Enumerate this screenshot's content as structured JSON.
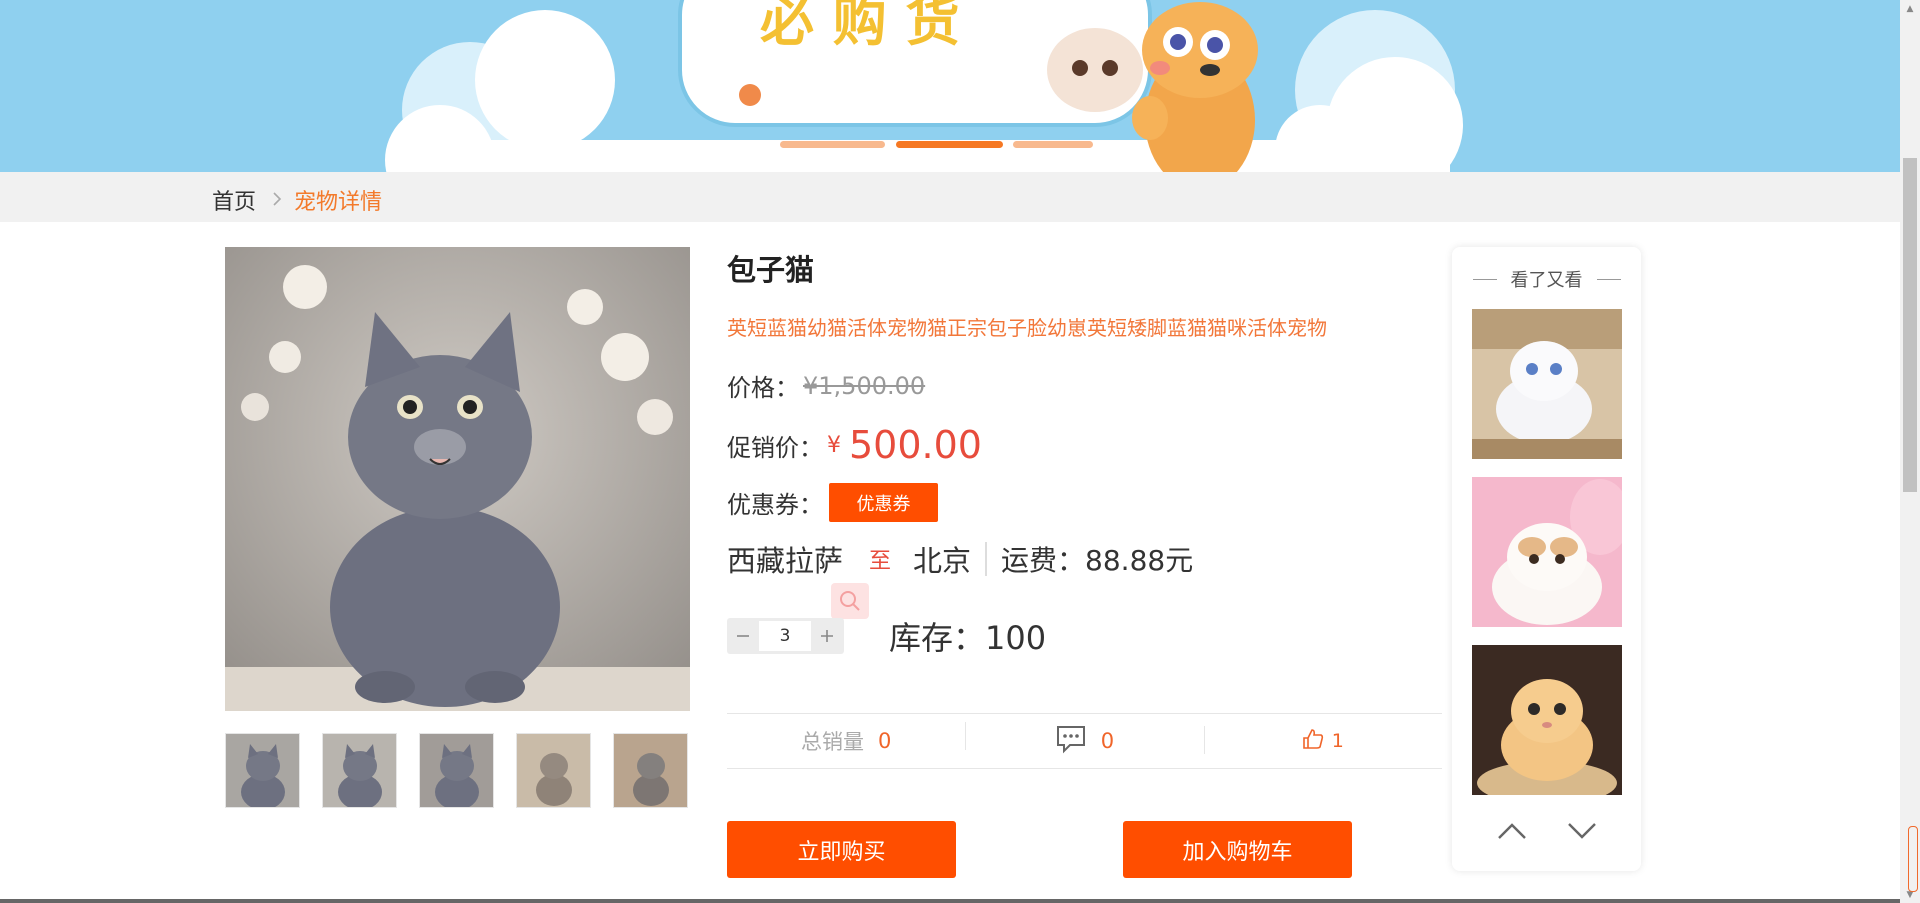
{
  "breadcrumb": {
    "home": "首页",
    "separator": ">",
    "current": "宠物详情"
  },
  "product": {
    "name": "包子猫",
    "subtitle": "英短蓝猫幼猫活体宠物猫正宗包子脸幼崽英短矮脚蓝猫猫咪活体宠物",
    "price_label": "价格：",
    "original_price": "¥1,500.00",
    "promo_label": "促销价：",
    "currency": "¥",
    "promo_price": "500.00",
    "coupon_label": "优惠券：",
    "coupon_button": "优惠券",
    "ship_from": "西藏拉萨",
    "ship_to_word": "至",
    "ship_to": "北京",
    "shipping_fee": "运费：88.88元",
    "quantity": "3",
    "stock": "库存：100",
    "stats": {
      "sales_label": "总销量",
      "sales_value": "0",
      "comments_value": "0",
      "likes_value": "1"
    },
    "buy_now": "立即购买",
    "add_to_cart": "加入购物车"
  },
  "side_panel": {
    "title": "看了又看"
  },
  "colors": {
    "accent": "#ff4e00",
    "price_red": "#e74c3c",
    "orange_text": "#f2773a",
    "banner_sky": "#8fd0ef"
  },
  "icons": [
    "chevron-right-icon",
    "search-icon",
    "minus-icon",
    "plus-icon",
    "comment-icon",
    "thumbs-up-icon",
    "chevron-up-icon",
    "chevron-down-icon"
  ]
}
